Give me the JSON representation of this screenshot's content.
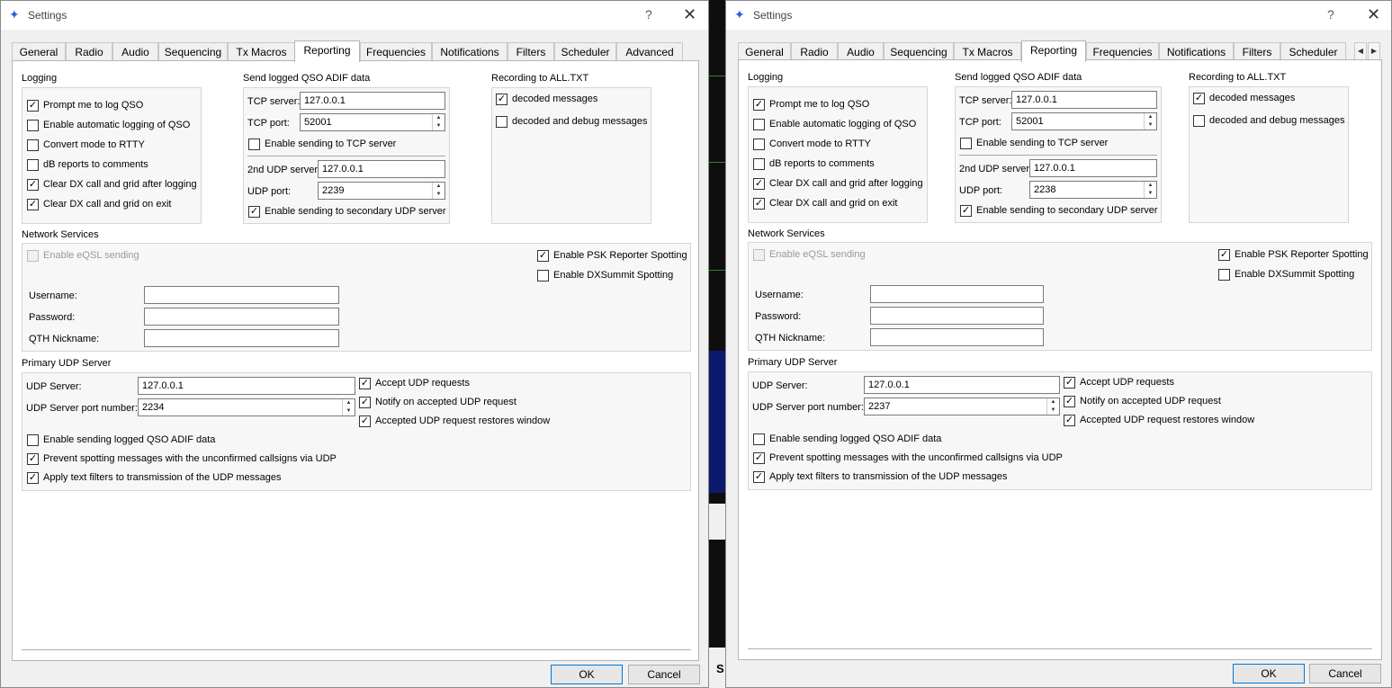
{
  "windows": [
    {
      "title": "Settings",
      "tabs": [
        "General",
        "Radio",
        "Audio",
        "Sequencing",
        "Tx Macros",
        "Reporting",
        "Frequencies",
        "Notifications",
        "Filters",
        "Scheduler",
        "Advanced"
      ],
      "active_tab": "Reporting",
      "logging": {
        "title": "Logging",
        "items": [
          {
            "label": "Prompt me to log QSO",
            "checked": true
          },
          {
            "label": "Enable automatic logging of QSO",
            "checked": false
          },
          {
            "label": "Convert mode to RTTY",
            "checked": false
          },
          {
            "label": "dB reports to comments",
            "checked": false
          },
          {
            "label": "Clear DX call and grid after logging",
            "checked": true
          },
          {
            "label": "Clear DX call and grid on exit",
            "checked": true
          }
        ]
      },
      "adif": {
        "title": "Send logged QSO ADIF data",
        "tcp_server_label": "TCP server:",
        "tcp_server": "127.0.0.1",
        "tcp_port_label": "TCP port:",
        "tcp_port": "52001",
        "tcp_enable": {
          "label": "Enable sending to TCP server",
          "checked": false
        },
        "udp2_label": "2nd UDP server",
        "udp2_server": "127.0.0.1",
        "udp_port_label": "UDP port:",
        "udp_port": "2239",
        "udp_enable": {
          "label": "Enable sending to secondary UDP server",
          "checked": true
        }
      },
      "alltxt": {
        "title": "Recording to ALL.TXT",
        "items": [
          {
            "label": "decoded messages",
            "checked": true
          },
          {
            "label": "decoded and debug messages",
            "checked": false
          }
        ]
      },
      "network": {
        "title": "Network Services",
        "eqsl": {
          "label": "Enable eQSL sending",
          "checked": false
        },
        "psk": {
          "label": "Enable PSK Reporter Spotting",
          "checked": true
        },
        "dxsummit": {
          "label": "Enable DXSummit Spotting",
          "checked": false
        },
        "username_label": "Username:",
        "username": "",
        "password_label": "Password:",
        "password": "",
        "qth_label": "QTH Nickname:",
        "qth": ""
      },
      "udp": {
        "title": "Primary UDP Server",
        "server_label": "UDP Server:",
        "server": "127.0.0.1",
        "port_label": "UDP Server port number:",
        "port": "2234",
        "accept": {
          "label": "Accept UDP requests",
          "checked": true
        },
        "notify": {
          "label": "Notify on accepted UDP request",
          "checked": true
        },
        "restore": {
          "label": "Accepted UDP request restores window",
          "checked": true
        },
        "adif_send": {
          "label": "Enable sending logged QSO ADIF data",
          "checked": false
        },
        "prevent": {
          "label": "Prevent spotting messages with the unconfirmed callsigns via UDP",
          "checked": true
        },
        "filters": {
          "label": "Apply text filters to transmission of the UDP messages",
          "checked": true
        }
      },
      "buttons": {
        "ok": "OK",
        "cancel": "Cancel"
      },
      "help_icon": "?",
      "close_icon": "✕"
    },
    {
      "title": "Settings",
      "tabs": [
        "General",
        "Radio",
        "Audio",
        "Sequencing",
        "Tx Macros",
        "Reporting",
        "Frequencies",
        "Notifications",
        "Filters",
        "Scheduler"
      ],
      "active_tab": "Reporting",
      "tab_scroll": {
        "left": "◀",
        "right": "▶"
      },
      "logging": {
        "title": "Logging",
        "items": [
          {
            "label": "Prompt me to log QSO",
            "checked": true
          },
          {
            "label": "Enable automatic logging of QSO",
            "checked": false
          },
          {
            "label": "Convert mode to RTTY",
            "checked": false
          },
          {
            "label": "dB reports to comments",
            "checked": false
          },
          {
            "label": "Clear DX call and grid after logging",
            "checked": true
          },
          {
            "label": "Clear DX call and grid on exit",
            "checked": true
          }
        ]
      },
      "adif": {
        "title": "Send logged QSO ADIF data",
        "tcp_server_label": "TCP server:",
        "tcp_server": "127.0.0.1",
        "tcp_port_label": "TCP port:",
        "tcp_port": "52001",
        "tcp_enable": {
          "label": "Enable sending to TCP server",
          "checked": false
        },
        "udp2_label": "2nd UDP server",
        "udp2_server": "127.0.0.1",
        "udp_port_label": "UDP port:",
        "udp_port": "2238",
        "udp_enable": {
          "label": "Enable sending to secondary UDP server",
          "checked": true
        }
      },
      "alltxt": {
        "title": "Recording to ALL.TXT",
        "items": [
          {
            "label": "decoded messages",
            "checked": true
          },
          {
            "label": "decoded and debug messages",
            "checked": false
          }
        ]
      },
      "network": {
        "title": "Network Services",
        "eqsl": {
          "label": "Enable eQSL sending",
          "checked": false
        },
        "psk": {
          "label": "Enable PSK Reporter Spotting",
          "checked": true
        },
        "dxsummit": {
          "label": "Enable DXSummit Spotting",
          "checked": false
        },
        "username_label": "Username:",
        "username": "",
        "password_label": "Password:",
        "password": "",
        "qth_label": "QTH Nickname:",
        "qth": ""
      },
      "udp": {
        "title": "Primary UDP Server",
        "server_label": "UDP Server:",
        "server": "127.0.0.1",
        "port_label": "UDP Server port number:",
        "port": "2237",
        "accept": {
          "label": "Accept UDP requests",
          "checked": true
        },
        "notify": {
          "label": "Notify on accepted UDP request",
          "checked": true
        },
        "restore": {
          "label": "Accepted UDP request restores window",
          "checked": true
        },
        "adif_send": {
          "label": "Enable sending logged QSO ADIF data",
          "checked": false
        },
        "prevent": {
          "label": "Prevent spotting messages with the unconfirmed callsigns via UDP",
          "checked": true
        },
        "filters": {
          "label": "Apply text filters to transmission of the UDP messages",
          "checked": true
        }
      },
      "buttons": {
        "ok": "OK",
        "cancel": "Cancel"
      },
      "help_icon": "?",
      "close_icon": "✕"
    }
  ],
  "background": {
    "side_letter": "S"
  }
}
